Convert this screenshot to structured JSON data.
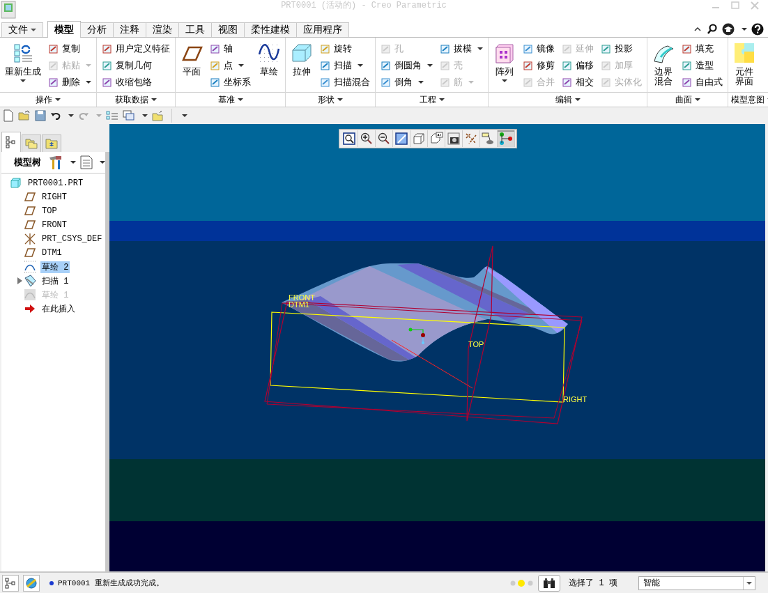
{
  "window": {
    "title": "PRT0001 (活动的) - Creo Parametric"
  },
  "file_menu": {
    "label": "文件"
  },
  "tabs": [
    {
      "label": "模型",
      "selected": true
    },
    {
      "label": "分析",
      "selected": false
    },
    {
      "label": "注释",
      "selected": false
    },
    {
      "label": "渲染",
      "selected": false
    },
    {
      "label": "工具",
      "selected": false
    },
    {
      "label": "视图",
      "selected": false
    },
    {
      "label": "柔性建模",
      "selected": false
    },
    {
      "label": "应用程序",
      "selected": false
    }
  ],
  "ribbon": {
    "groups": [
      {
        "label": "操作",
        "columns": [
          [
            {
              "label": "重新生成",
              "kind": "large",
              "disabled": false,
              "dropdown": true
            }
          ],
          [
            {
              "label": "复制",
              "kind": "small",
              "disabled": false,
              "dropdown": false
            },
            {
              "label": "粘贴",
              "kind": "small",
              "disabled": true,
              "dropdown": true
            },
            {
              "label": "删除",
              "kind": "small",
              "disabled": false,
              "dropdown": true
            }
          ]
        ]
      },
      {
        "label": "获取数据",
        "columns": [
          [
            {
              "label": "用户定义特征",
              "kind": "small",
              "disabled": false,
              "dropdown": false
            },
            {
              "label": "复制几何",
              "kind": "small",
              "disabled": false,
              "dropdown": false
            },
            {
              "label": "收缩包络",
              "kind": "small",
              "disabled": false,
              "dropdown": false
            }
          ]
        ]
      },
      {
        "label": "基准",
        "columns": [
          [
            {
              "label": "平面",
              "kind": "large",
              "disabled": false,
              "dropdown": false
            }
          ],
          [
            {
              "label": "轴",
              "kind": "small",
              "disabled": false,
              "dropdown": false
            },
            {
              "label": "点",
              "kind": "small",
              "disabled": false,
              "dropdown": true
            },
            {
              "label": "坐标系",
              "kind": "small",
              "disabled": false,
              "dropdown": false
            }
          ],
          [
            {
              "label": "草绘",
              "kind": "large",
              "disabled": false,
              "dropdown": false
            }
          ]
        ]
      },
      {
        "label": "形状",
        "columns": [
          [
            {
              "label": "拉伸",
              "kind": "large",
              "disabled": false,
              "dropdown": false
            }
          ],
          [
            {
              "label": "旋转",
              "kind": "small",
              "disabled": false,
              "dropdown": false
            },
            {
              "label": "扫描",
              "kind": "small",
              "disabled": false,
              "dropdown": true
            },
            {
              "label": "扫描混合",
              "kind": "small",
              "disabled": false,
              "dropdown": false
            }
          ]
        ]
      },
      {
        "label": "工程",
        "columns": [
          [
            {
              "label": "孔",
              "kind": "small",
              "disabled": true,
              "dropdown": false
            },
            {
              "label": "倒圆角",
              "kind": "small",
              "disabled": false,
              "dropdown": true
            },
            {
              "label": "倒角",
              "kind": "small",
              "disabled": false,
              "dropdown": true
            }
          ],
          [
            {
              "label": "拔模",
              "kind": "small",
              "disabled": false,
              "dropdown": true
            },
            {
              "label": "壳",
              "kind": "small",
              "disabled": true,
              "dropdown": false
            },
            {
              "label": "筋",
              "kind": "small",
              "disabled": true,
              "dropdown": true
            }
          ]
        ]
      },
      {
        "label": "编辑",
        "columns": [
          [
            {
              "label": "阵列",
              "kind": "large",
              "disabled": false,
              "dropdown": true
            }
          ],
          [
            {
              "label": "镜像",
              "kind": "small",
              "disabled": false,
              "dropdown": false
            },
            {
              "label": "修剪",
              "kind": "small",
              "disabled": false,
              "dropdown": false
            },
            {
              "label": "合并",
              "kind": "small",
              "disabled": true,
              "dropdown": false
            }
          ],
          [
            {
              "label": "延伸",
              "kind": "small",
              "disabled": true,
              "dropdown": false
            },
            {
              "label": "偏移",
              "kind": "small",
              "disabled": false,
              "dropdown": false
            },
            {
              "label": "相交",
              "kind": "small",
              "disabled": false,
              "dropdown": false
            }
          ],
          [
            {
              "label": "投影",
              "kind": "small",
              "disabled": false,
              "dropdown": false
            },
            {
              "label": "加厚",
              "kind": "small",
              "disabled": true,
              "dropdown": false
            },
            {
              "label": "实体化",
              "kind": "small",
              "disabled": true,
              "dropdown": false
            }
          ]
        ]
      },
      {
        "label": "曲面",
        "columns": [
          [
            {
              "lines": [
                "边界",
                "混合"
              ],
              "kind": "large",
              "disabled": false,
              "dropdown": false
            }
          ],
          [
            {
              "label": "填充",
              "kind": "small",
              "disabled": false,
              "dropdown": false
            },
            {
              "label": "造型",
              "kind": "small",
              "disabled": false,
              "dropdown": false
            },
            {
              "label": "自由式",
              "kind": "small",
              "disabled": false,
              "dropdown": false
            }
          ]
        ]
      },
      {
        "label": "模型意图",
        "columns": [
          [
            {
              "lines": [
                "元件",
                "界面"
              ],
              "kind": "large",
              "disabled": false,
              "dropdown": false
            }
          ]
        ]
      }
    ]
  },
  "panel_tabs": [
    {
      "kind": "tree",
      "selected": true
    },
    {
      "kind": "folders",
      "selected": false
    },
    {
      "kind": "favorites",
      "selected": false
    }
  ],
  "model_tree": {
    "title": "模型树",
    "root": {
      "label": "PRT0001.PRT",
      "kind": "part",
      "selected": false,
      "disabled": false,
      "children": [
        {
          "label": "RIGHT",
          "kind": "plane",
          "selected": false,
          "disabled": false
        },
        {
          "label": "TOP",
          "kind": "plane",
          "selected": false,
          "disabled": false
        },
        {
          "label": "FRONT",
          "kind": "plane",
          "selected": false,
          "disabled": false
        },
        {
          "label": "PRT_CSYS_DEF",
          "kind": "csys",
          "selected": false,
          "disabled": false
        },
        {
          "label": "DTM1",
          "kind": "plane",
          "selected": false,
          "disabled": false
        },
        {
          "label": "草绘 2",
          "kind": "sketch",
          "selected": true,
          "disabled": false
        },
        {
          "label": "扫描 1",
          "kind": "sweep",
          "selected": false,
          "disabled": false,
          "expanded": false
        },
        {
          "label": "草绘 1",
          "kind": "sketch",
          "selected": false,
          "disabled": true
        },
        {
          "label": "在此插入",
          "kind": "insert",
          "selected": false,
          "disabled": false
        }
      ]
    }
  },
  "view_toolbar": [
    {
      "kind": "refit",
      "selected": false
    },
    {
      "kind": "zoom-in",
      "selected": false
    },
    {
      "kind": "zoom-out",
      "selected": false
    },
    {
      "kind": "repaint",
      "selected": false
    },
    {
      "kind": "display-style",
      "selected": false
    },
    {
      "kind": "saved-views",
      "selected": false
    },
    {
      "kind": "view-manager",
      "selected": false
    },
    {
      "kind": "datum-display",
      "selected": false
    },
    {
      "kind": "spin-center",
      "selected": false
    },
    {
      "kind": "annotation-display",
      "selected": true
    }
  ],
  "datum_labels": [
    "FRONT",
    "DTM1",
    "TOP",
    "RIGHT"
  ],
  "status_bar": {
    "message": "PRT0001 重新生成成功完成。",
    "selection": "选择了 1 项",
    "filter": "智能"
  }
}
